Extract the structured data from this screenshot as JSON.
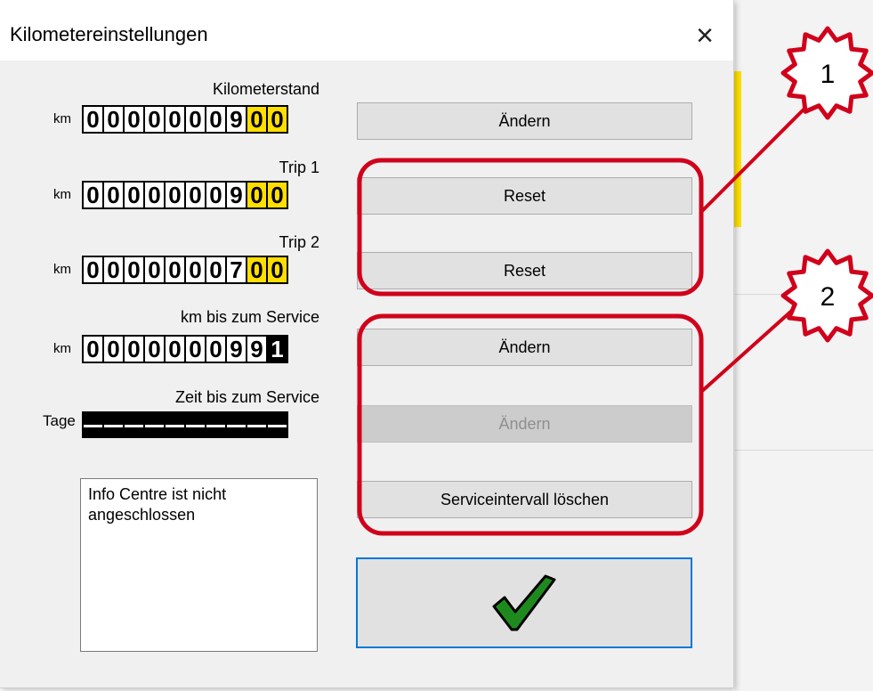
{
  "dialog": {
    "title": "Kilometereinstellungen",
    "close_glyph": "×"
  },
  "rows": [
    {
      "label": "Kilometerstand",
      "unit": "km",
      "digits": "0000000900",
      "button": "Ändern"
    },
    {
      "label": "Trip 1",
      "unit": "km",
      "digits": "0000000900",
      "button": "Reset"
    },
    {
      "label": "Trip 2",
      "unit": "km",
      "digits": "0000000700",
      "button": "Reset"
    },
    {
      "label": "km bis zum Service",
      "unit": "km",
      "digits": "0000000991",
      "button": "Ändern"
    },
    {
      "label": "Zeit bis zum Service",
      "unit": "Tage",
      "digits": "----------",
      "button": "Ändern"
    }
  ],
  "service_reset_button": "Serviceintervall löschen",
  "info_text": "Info Centre ist nicht angeschlossen",
  "ok_icon": "checkmark-icon",
  "annotations": {
    "badge1": "1",
    "badge2": "2",
    "color": "#d0021b"
  },
  "colors": {
    "odometer_bg": "#000000",
    "odometer_yellow": "#ffde00",
    "focus_border": "#0078d7",
    "check_green": "#1e8a1e"
  }
}
